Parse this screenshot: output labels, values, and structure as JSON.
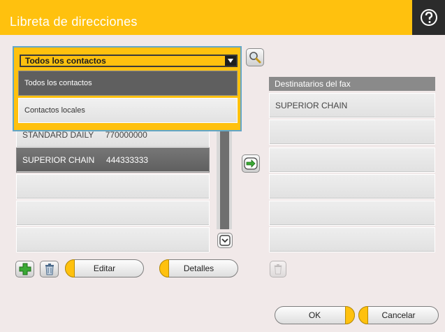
{
  "header": {
    "title": "Libreta de direcciones",
    "help_icon": "question-circle-icon"
  },
  "contacts_dropdown": {
    "selected": "Todos los contactos",
    "options": [
      "Todos los contactos",
      "Contactos locales"
    ]
  },
  "contacts_list": {
    "rows": [
      {
        "text": "STANDARD DAILY     770000000"
      },
      {
        "text": "SUPERIOR CHAIN     444333333",
        "selected": true
      },
      {
        "text": ""
      },
      {
        "text": ""
      },
      {
        "text": ""
      }
    ]
  },
  "fax_recipients": {
    "header": "Destinatarios del fax",
    "rows": [
      "SUPERIOR CHAIN",
      "",
      "",
      "",
      "",
      ""
    ]
  },
  "buttons": {
    "edit": "Editar",
    "details": "Detalles",
    "ok": "OK",
    "cancel": "Cancelar"
  },
  "colors": {
    "accent": "#ffc10e",
    "selected_row": "#5f5f5f",
    "add_green": "#3aa935",
    "focus_blue": "#62a6c8"
  }
}
